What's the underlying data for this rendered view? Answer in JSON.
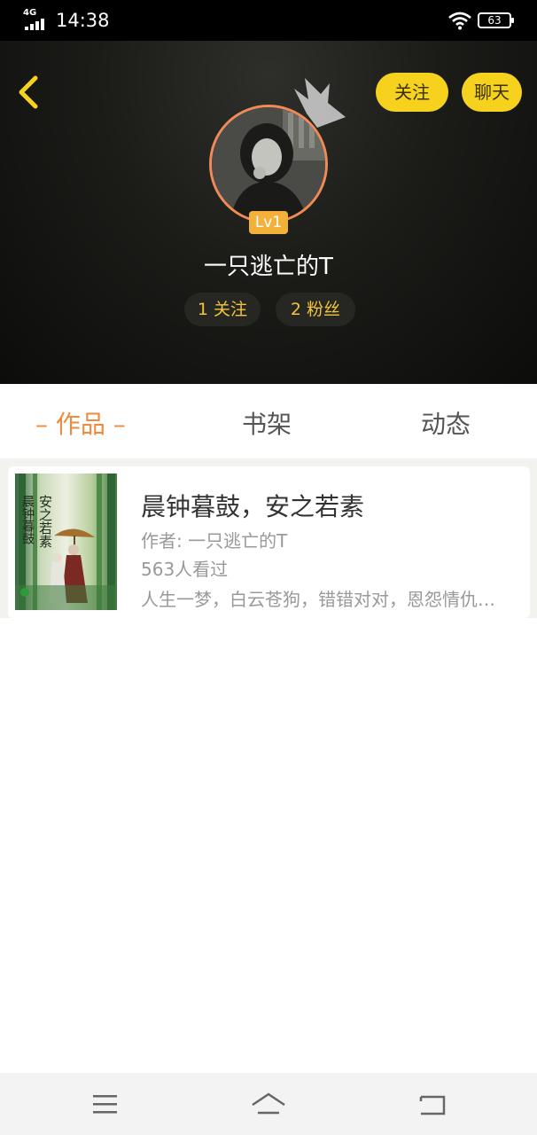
{
  "status_bar": {
    "network": "4G",
    "time": "14:38",
    "battery": "63"
  },
  "header": {
    "follow_label": "关注",
    "chat_label": "聊天",
    "level": "Lv1",
    "username": "一只逃亡的T",
    "following_text": "1 关注",
    "fans_text": "2 粉丝"
  },
  "tabs": [
    {
      "label": "– 作品 –",
      "active": true
    },
    {
      "label": "书架",
      "active": false
    },
    {
      "label": "动态",
      "active": false
    }
  ],
  "books": [
    {
      "title": "晨钟暮鼓，安之若素",
      "author": "作者: 一只逃亡的T",
      "views": "563人看过",
      "intro": "人生一梦，白云苍狗，错错对对，恩怨情仇皆过眼云烟"
    }
  ],
  "colors": {
    "accent": "#f08a3e",
    "pill": "#f6d21f",
    "stat_text": "#f2c53a",
    "avatar_ring": "#f08a57"
  },
  "icons": {
    "back": "chevron-left-icon",
    "crown": "crown-icon",
    "wifi": "wifi-icon",
    "battery": "battery-icon",
    "menu": "menu-icon",
    "home": "home-icon",
    "return": "return-icon"
  }
}
